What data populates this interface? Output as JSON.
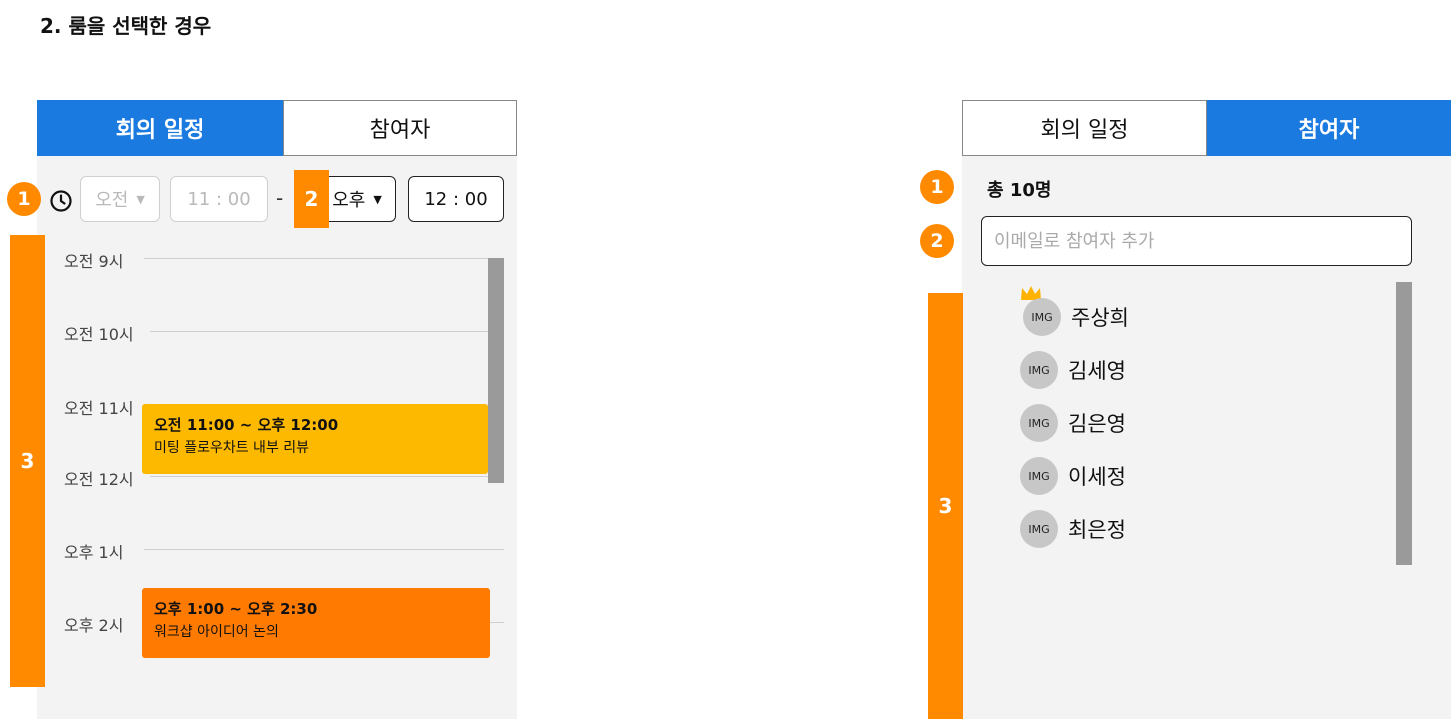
{
  "page_title": "2. 룸을 선택한 경우",
  "colors": {
    "accent": "#1a7ae0",
    "marker": "#ff8a00",
    "event_yellow": "#fcb900",
    "event_orange": "#ff7a00"
  },
  "left_panel": {
    "tabs": [
      {
        "label": "회의 일정",
        "active": true
      },
      {
        "label": "참여자",
        "active": false
      }
    ],
    "markers": {
      "one": "1",
      "two": "2",
      "three": "3"
    },
    "start_ampm": "오전",
    "start_time": "11 : 00",
    "separator": "-",
    "end_ampm": "오후",
    "end_time": "12 : 00",
    "clock_icon": "clock-icon",
    "hours": [
      "오전 9시",
      "오전 10시",
      "오전 11시",
      "오전 12시",
      "오후 1시",
      "오후 2시"
    ],
    "events": [
      {
        "time": "오전 11:00 ~ 오후 12:00",
        "title": "미팅 플로우차트 내부 리뷰"
      },
      {
        "time": "오후 1:00 ~ 오후 2:30",
        "title": "워크샵 아이디어 논의"
      }
    ]
  },
  "right_panel": {
    "tabs": [
      {
        "label": "회의 일정",
        "active": false
      },
      {
        "label": "참여자",
        "active": true
      }
    ],
    "markers": {
      "one": "1",
      "two": "2",
      "three": "3"
    },
    "total": "총 10명",
    "email_placeholder": "이메일로 참여자 추가",
    "members": [
      {
        "avatar": "IMG",
        "name": "주상희",
        "owner": true
      },
      {
        "avatar": "IMG",
        "name": "김세영",
        "owner": false
      },
      {
        "avatar": "IMG",
        "name": "김은영",
        "owner": false
      },
      {
        "avatar": "IMG",
        "name": "이세정",
        "owner": false
      },
      {
        "avatar": "IMG",
        "name": "최은정",
        "owner": false
      }
    ],
    "owner_icon": "crown-icon"
  }
}
